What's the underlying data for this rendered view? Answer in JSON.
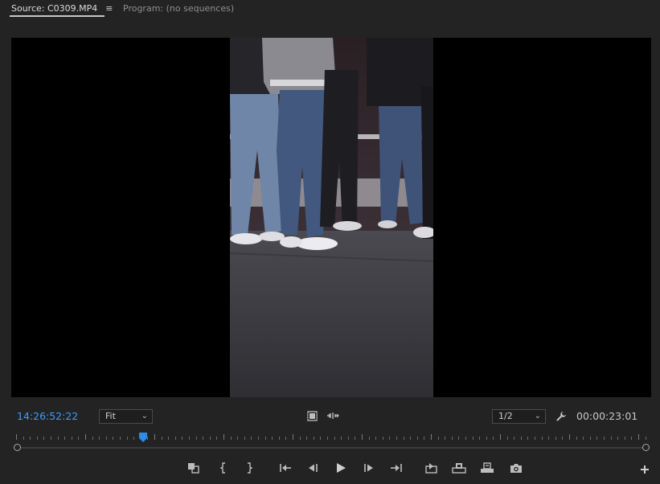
{
  "tabs": {
    "source_label": "Source: C0309.MP4",
    "menu_glyph": "≡",
    "program_label": "Program: (no sequences)"
  },
  "controls": {
    "current_timecode": "14:26:52:22",
    "zoom_value": "Fit",
    "resolution_value": "1/2",
    "duration_timecode": "00:00:23:01"
  },
  "icons": {
    "insert_overwrite_toggle": "drag-video-icon",
    "drag_audio": "drag-audio-icon",
    "settings": "wrench-icon",
    "add": "plus-icon"
  },
  "transport": [
    {
      "name": "export-frame-icon"
    },
    {
      "name": "mark-in-icon"
    },
    {
      "name": "mark-out-icon"
    },
    {
      "name": "go-to-in-icon"
    },
    {
      "name": "step-back-icon"
    },
    {
      "name": "play-icon"
    },
    {
      "name": "step-forward-icon"
    },
    {
      "name": "go-to-out-icon"
    },
    {
      "name": "insert-icon"
    },
    {
      "name": "overwrite-icon"
    },
    {
      "name": "export-frame-2-icon"
    },
    {
      "name": "camera-icon"
    }
  ],
  "colors": {
    "timecode_accent": "#3b9cff",
    "panel_bg": "#232323",
    "viewer_bg": "#000000"
  },
  "playhead_fraction": 0.2
}
